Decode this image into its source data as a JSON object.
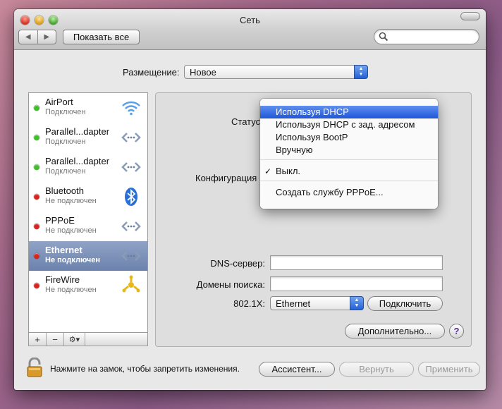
{
  "window": {
    "title": "Сеть"
  },
  "toolbar": {
    "show_all": "Показать все",
    "back_icon": "◀",
    "forward_icon": "▶"
  },
  "search": {
    "placeholder": ""
  },
  "location": {
    "label": "Размещение:",
    "value": "Новое"
  },
  "services": [
    {
      "name": "AirPort",
      "status": "Подключен",
      "status_color": "#3fbf2a",
      "icon": "wifi-icon",
      "selected": false
    },
    {
      "name": "Parallel...dapter",
      "status": "Подключен",
      "status_color": "#3fbf2a",
      "icon": "ethernet-icon",
      "selected": false
    },
    {
      "name": "Parallel...dapter",
      "status": "Подключен",
      "status_color": "#3fbf2a",
      "icon": "ethernet-icon",
      "selected": false
    },
    {
      "name": "Bluetooth",
      "status": "Не подключен",
      "status_color": "#d8231f",
      "icon": "bluetooth-icon",
      "selected": false
    },
    {
      "name": "PPPoE",
      "status": "Не подключен",
      "status_color": "#d8231f",
      "icon": "ethernet-icon",
      "selected": false
    },
    {
      "name": "Ethernet",
      "status": "Не подключен",
      "status_color": "#d8231f",
      "icon": "ethernet-icon",
      "selected": true
    },
    {
      "name": "FireWire",
      "status": "Не подключен",
      "status_color": "#d8231f",
      "icon": "firewire-icon",
      "selected": false
    }
  ],
  "list_actions": {
    "add": "+",
    "remove": "−",
    "gear": "⚙▾"
  },
  "detail": {
    "status_label": "Статус",
    "config_label": "Конфигурация",
    "dns_label": "DNS-сервер:",
    "dns_value": "",
    "search_domains_label": "Домены поиска:",
    "search_domains_value": "",
    "dot1x_label": "802.1X:",
    "dot1x_value": "Ethernet",
    "connect_button": "Подключить",
    "advanced_button": "Дополнительно...",
    "help_button": "?"
  },
  "config_menu": {
    "items": [
      {
        "label": "Используя DHCP",
        "highlighted": true,
        "checked": false
      },
      {
        "label": "Используя DHCP с зад. адресом",
        "highlighted": false,
        "checked": false
      },
      {
        "label": "Используя BootP",
        "highlighted": false,
        "checked": false
      },
      {
        "label": "Вручную",
        "highlighted": false,
        "checked": false
      },
      {
        "label": "Выкл.",
        "highlighted": false,
        "checked": true
      },
      {
        "label": "Создать службу PPPoE...",
        "highlighted": false,
        "checked": false
      }
    ],
    "checkmark": "✓"
  },
  "bottom": {
    "lock_text": "Нажмите на замок, чтобы запретить изменения.",
    "assistant_button": "Ассистент...",
    "revert_button": "Вернуть",
    "apply_button": "Применить"
  },
  "colors": {
    "selection": "#6b82ad",
    "menu_highlight": "#1f55d8",
    "popup_accent": "#2560d6"
  }
}
